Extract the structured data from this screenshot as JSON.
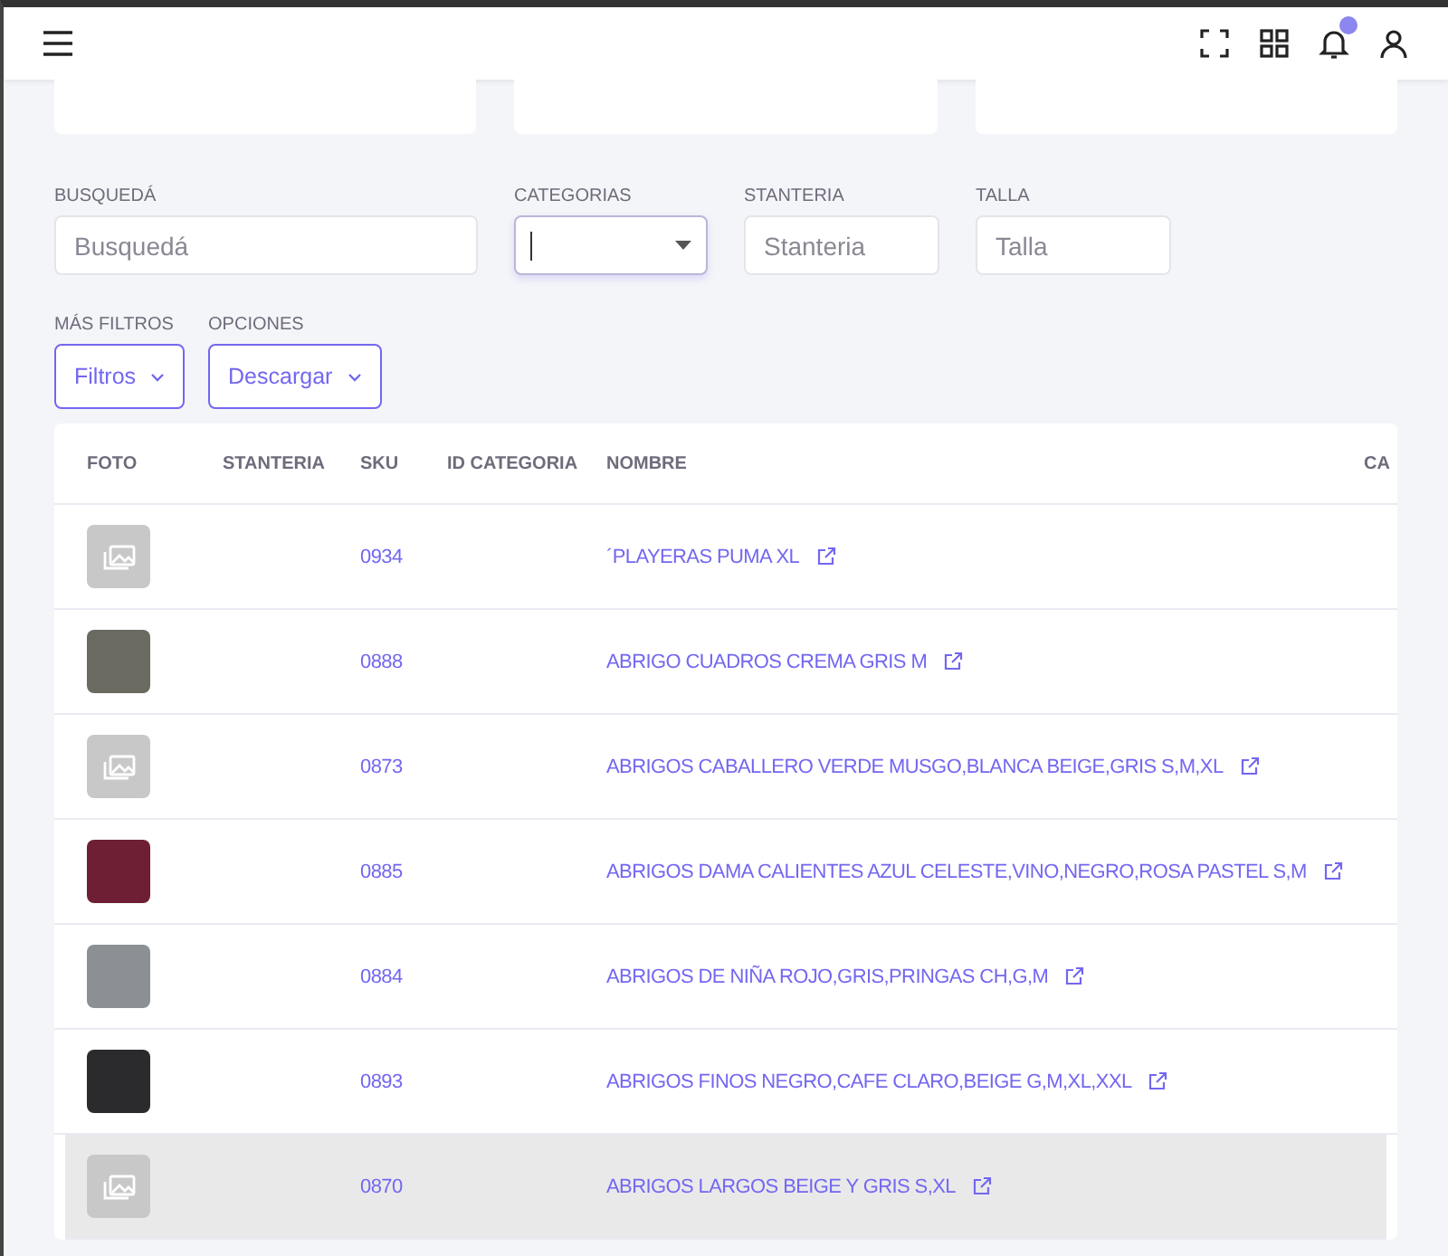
{
  "filters": [
    {
      "label": "BUSQUEDÁ",
      "kind": "text",
      "placeholder": "Busquedá",
      "focused": false
    },
    {
      "label": "CATEGORIAS",
      "kind": "select",
      "focused": true
    },
    {
      "label": "STANTERIA",
      "kind": "text",
      "placeholder": "Stanteria",
      "focused": false
    },
    {
      "label": "TALLA",
      "kind": "text",
      "placeholder": "Talla",
      "focused": false
    }
  ],
  "menus": [
    {
      "label": "MÁS FILTROS",
      "button": "Filtros"
    },
    {
      "label": "OPCIONES",
      "button": "Descargar"
    }
  ],
  "table": {
    "columns": [
      "FOTO",
      "STANTERIA",
      "SKU",
      "ID CATEGORIA",
      "NOMBRE",
      "CA"
    ],
    "rows": [
      {
        "kind": "placeholder",
        "sku": "0934",
        "nombre": "´PLAYERAS PUMA XL",
        "highlighted": false
      },
      {
        "kind": "photo",
        "color": "#6b6a60",
        "sku": "0888",
        "nombre": "ABRIGO CUADROS CREMA GRIS M",
        "highlighted": false
      },
      {
        "kind": "placeholder",
        "sku": "0873",
        "nombre": "ABRIGOS CABALLERO VERDE MUSGO,BLANCA BEIGE,GRIS S,M,XL",
        "highlighted": false
      },
      {
        "kind": "photo",
        "color": "#6e1f33",
        "sku": "0885",
        "nombre": "ABRIGOS DAMA CALIENTES AZUL CELESTE,VINO,NEGRO,ROSA PASTEL S,M",
        "highlighted": false
      },
      {
        "kind": "photo",
        "color": "#8c8f94",
        "sku": "0884",
        "nombre": "ABRIGOS DE NIÑA ROJO,GRIS,PRINGAS CH,G,M",
        "highlighted": false
      },
      {
        "kind": "photo",
        "color": "#2b2b2e",
        "sku": "0893",
        "nombre": "ABRIGOS FINOS NEGRO,CAFE CLARO,BEIGE G,M,XL,XXL",
        "highlighted": false
      },
      {
        "kind": "placeholder",
        "sku": "0870",
        "nombre": "ABRIGOS LARGOS BEIGE Y GRIS S,XL",
        "highlighted": true
      }
    ]
  }
}
